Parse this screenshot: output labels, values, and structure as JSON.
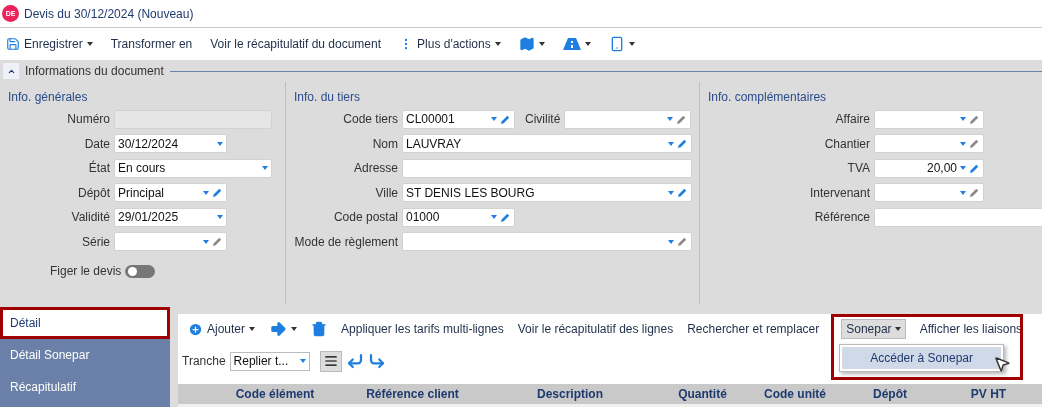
{
  "window": {
    "badge": "DE",
    "title": "Devis du 30/12/2024 (Nouveau)"
  },
  "toolbar": [
    {
      "kind": "save",
      "label": "Enregistrer",
      "menu": true
    },
    {
      "kind": "text",
      "label": "Transformer en",
      "menu": false
    },
    {
      "kind": "text",
      "label": "Voir le récapitulatif du document",
      "menu": false
    },
    {
      "kind": "more",
      "label": "Plus d'actions",
      "menu": true
    },
    {
      "kind": "map",
      "menu": true
    },
    {
      "kind": "road",
      "menu": true
    },
    {
      "kind": "phone",
      "menu": true
    }
  ],
  "section": {
    "title": "Informations du document",
    "expanded": true
  },
  "columns": [
    {
      "title": "Info. générales",
      "rows": [
        [
          {
            "label": "Numéro",
            "kind": "text",
            "disabled": true
          }
        ],
        [
          {
            "label": "Date",
            "kind": "date",
            "value": "30/12/2024"
          }
        ],
        [
          {
            "label": "État",
            "kind": "select",
            "value": "En cours"
          }
        ],
        [
          {
            "label": "Dépôt",
            "kind": "lookup",
            "value": "Principal",
            "editable": true
          }
        ],
        [
          {
            "label": "Validité",
            "kind": "date",
            "value": "29/01/2025"
          }
        ],
        [
          {
            "label": "Série",
            "kind": "lookup",
            "editable": false
          }
        ]
      ],
      "toggle": {
        "label": "Figer le devis",
        "on": false
      }
    },
    {
      "title": "Info. du tiers",
      "rows": [
        [
          {
            "label": "Code tiers",
            "kind": "lookup",
            "value": "CL00001",
            "editable": true
          },
          {
            "label": "Civilité",
            "kind": "combo",
            "editable": false
          }
        ],
        [
          {
            "label": "Nom",
            "kind": "combo",
            "value": "LAUVRAY",
            "editable": true
          }
        ],
        [
          {
            "label": "Adresse",
            "kind": "text"
          }
        ],
        [
          {
            "label": "Ville",
            "kind": "combo",
            "value": "ST DENIS LES BOURG",
            "editable": true
          }
        ],
        [
          {
            "label": "Code postal",
            "kind": "lookup",
            "value": "01000",
            "editable": true
          }
        ],
        [
          {
            "label": "Mode de règlement",
            "kind": "combo",
            "editable": false
          }
        ]
      ]
    },
    {
      "title": "Info. complémentaires",
      "rows": [
        [
          {
            "label": "Affaire",
            "kind": "lookup",
            "editable": false
          }
        ],
        [
          {
            "label": "Chantier",
            "kind": "lookup",
            "editable": false
          }
        ],
        [
          {
            "label": "TVA",
            "kind": "numeric",
            "value": "20,00",
            "editable": true
          }
        ],
        [
          {
            "label": "Intervenant",
            "kind": "lookup",
            "editable": false
          }
        ],
        [
          {
            "label": "Référence",
            "kind": "text"
          }
        ]
      ]
    }
  ],
  "tabs": [
    {
      "label": "Détail",
      "selected": true
    },
    {
      "label": "Détail Sonepar",
      "selected": false
    },
    {
      "label": "Récapitulatif",
      "selected": false
    }
  ],
  "lines_toolbar": [
    {
      "kind": "add",
      "label": "Ajouter",
      "menu": true
    },
    {
      "kind": "arrow",
      "menu": true
    },
    {
      "kind": "trash",
      "menu": false
    },
    {
      "kind": "text",
      "label": "Appliquer les tarifs multi-lignes",
      "menu": false
    },
    {
      "kind": "text",
      "label": "Voir le récapitulatif des lignes",
      "menu": false
    },
    {
      "kind": "text",
      "label": "Rechercher et remplacer",
      "menu": false
    },
    {
      "kind": "dropdown",
      "label": "Sonepar",
      "menu": true,
      "expanded": true,
      "items": [
        "Accéder à Sonepar"
      ]
    },
    {
      "kind": "text",
      "label": "Afficher les liaisons",
      "menu": false
    }
  ],
  "tranche": {
    "label": "Tranche",
    "value": "Replier t..."
  },
  "table": {
    "columns": [
      "Code élément",
      "Référence client",
      "Description",
      "Quantité",
      "Code unité",
      "Dépôt",
      "PV HT"
    ]
  }
}
